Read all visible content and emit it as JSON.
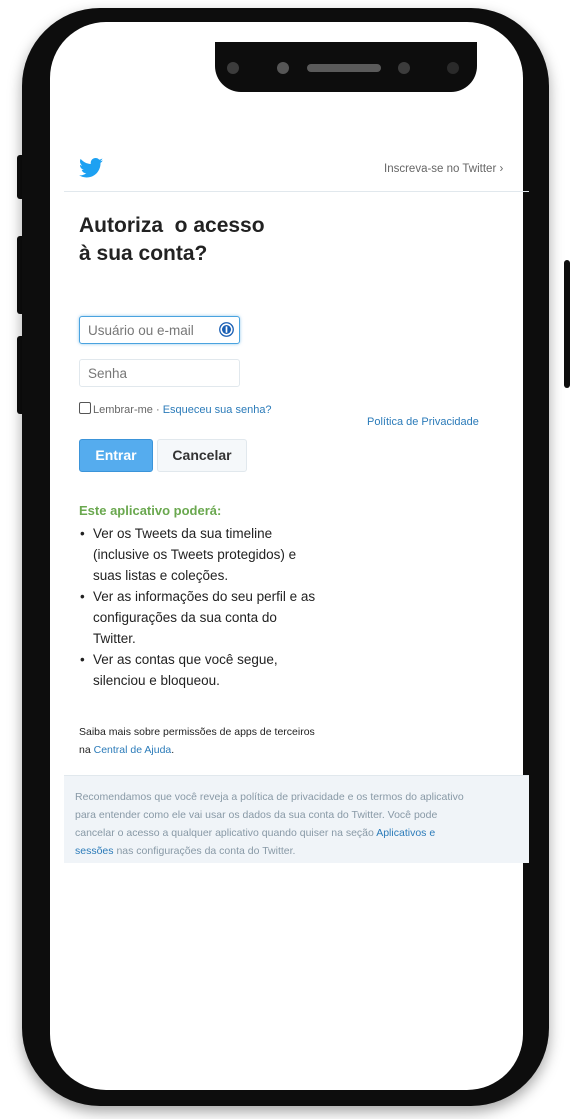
{
  "header": {
    "signup_link": "Inscreva-se no Twitter ›"
  },
  "title": {
    "line1": "Autoriza  o acesso",
    "line2": "à sua conta?"
  },
  "form": {
    "username_placeholder": "Usuário ou e-mail",
    "password_placeholder": "Senha",
    "remember_me": "Lembrar-me",
    "separator": " · ",
    "forgot_password": "Esqueceu sua senha?",
    "privacy_policy": "Política de Privacidade",
    "submit_label": "Entrar",
    "cancel_label": "Cancelar"
  },
  "permissions": {
    "heading": "Este aplicativo poderá:",
    "bullet": "•",
    "items": [
      {
        "line1": "Ver os Tweets da sua timeline",
        "line2": "(inclusive os Tweets protegidos) e",
        "line3": "suas listas e coleções."
      },
      {
        "line1": "Ver as informações do seu perfil e as",
        "line2": "configurações da sua conta do",
        "line3": "Twitter."
      },
      {
        "line1": "Ver as contas que você segue,",
        "line2": "silenciou e bloqueou."
      }
    ]
  },
  "learn_more": {
    "line1": "Saiba mais sobre permissões de apps de terceiros",
    "prefix": "na ",
    "help_link": "Central de Ajuda",
    "suffix": "."
  },
  "notice": {
    "line1": "Recomendamos que você reveja a política de privacidade e os termos do aplicativo",
    "line2": "para entender como ele vai usar os dados da sua conta do Twitter. Você pode",
    "line3_prefix": "cancelar o acesso a qualquer aplicativo quando quiser na seção ",
    "line3_link": "Aplicativos e",
    "line4_link": "sessões",
    "line4_suffix": " nas configurações da conta do Twitter."
  },
  "icons": {
    "brand": "twitter-bird-icon",
    "password_manager": "password-manager-icon"
  },
  "colors": {
    "brand_blue": "#1da1f2",
    "link": "#2b7bb9",
    "button_primary": "#55acee",
    "permission_heading": "#6aa84f"
  }
}
